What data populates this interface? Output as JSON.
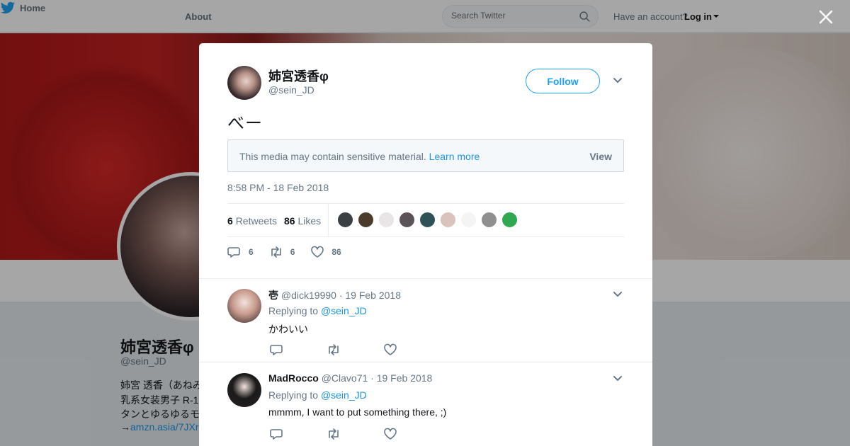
{
  "nav": {
    "home_label": "Home",
    "about_label": "About",
    "search_placeholder": "Search Twitter",
    "account_prompt": "Have an account?",
    "login_label": "Log in"
  },
  "profile": {
    "name": "姉宮透香φ",
    "handle": "@sein_JD",
    "bio_lines": [
      "姉宮 透香（あねみ",
      "乳系女装男子 R-1",
      "タンとゆるゆるモ"
    ],
    "bio_link_prefix": "→",
    "bio_link": "amzn.asia/7JXr"
  },
  "tweet": {
    "author_name": "姉宮透香φ",
    "author_handle": "@sein_JD",
    "follow_label": "Follow",
    "text": "べー",
    "sensitive_message": "This media may contain sensitive material.",
    "learn_more": "Learn more",
    "view_label": "View",
    "timestamp": "8:58 PM - 18 Feb 2018",
    "retweets_count": "6",
    "retweets_label": "Retweets",
    "likes_count": "86",
    "likes_label": "Likes",
    "reply_count": "6",
    "retweet_action_count": "6",
    "like_action_count": "86"
  },
  "likers": [
    {
      "color": "#3a3f44"
    },
    {
      "color": "#4a3b2a"
    },
    {
      "color": "#e9e4e6"
    },
    {
      "color": "#5b5358"
    },
    {
      "color": "#2f5257"
    },
    {
      "color": "#d9c3bc"
    },
    {
      "color": "#f4f4f4"
    },
    {
      "color": "#8f8f8f"
    },
    {
      "color": "#2fa84f"
    }
  ],
  "replies": [
    {
      "name": "壱",
      "handle": "@dick19990",
      "date": "· 19 Feb 2018",
      "replying_prefix": "Replying to",
      "mention": "@sein_JD",
      "text": "かわいい",
      "avatar_color": "#c89a8c"
    },
    {
      "name": "MadRocco",
      "handle": "@Clavo71",
      "date": "· 19 Feb 2018",
      "replying_prefix": "Replying to",
      "mention": "@sein_JD",
      "text": "mmmm, I want to put something there,  ;)",
      "avatar_color": "#1a1a1a"
    }
  ],
  "colors": {
    "accent": "#1da1f2",
    "link": "#1b95e0",
    "muted": "#657786"
  }
}
